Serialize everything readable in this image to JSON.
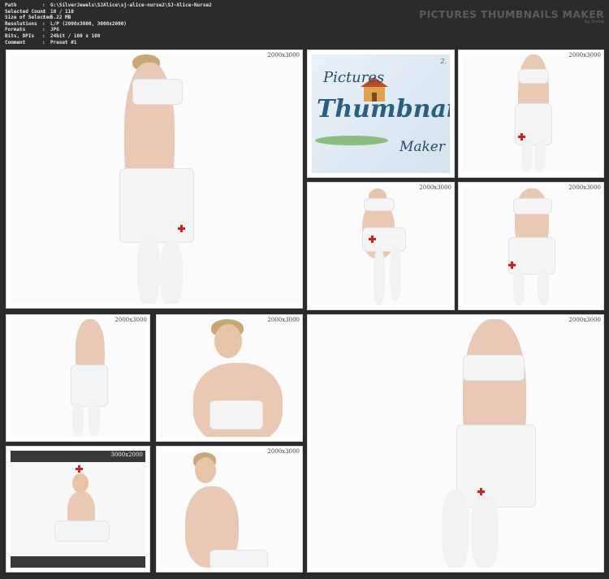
{
  "header": {
    "fields": [
      {
        "key": "Path",
        "value": "G:\\SilverJewels\\SJAlice\\sj-alice-nurse2\\SJ-Alice-Nurse2"
      },
      {
        "key": "Selected Count",
        "value": "10 / 110"
      },
      {
        "key": "Size of Selected",
        "value": "5.22 MB"
      },
      {
        "key": "Resolutions",
        "value": "L/P (2000x3000, 3000x2000)"
      },
      {
        "key": "Formats",
        "value": "JPG"
      },
      {
        "key": "Bits, DPIs",
        "value": "24bit / 100 x 100"
      },
      {
        "key": "Comment",
        "value": "Preset #1"
      }
    ],
    "separator": ":",
    "brand_title": "PICTURES THUMBNAILS MAKER",
    "brand_subtitle": "by Scorp"
  },
  "logo": {
    "word1": "Pictures",
    "word2": "Thumbnails",
    "word3": "Maker",
    "version": "2."
  },
  "thumbnails": [
    {
      "id": "t1",
      "resolution": "2000x3000",
      "orientation": "portrait"
    },
    {
      "id": "t3",
      "resolution": "2000x3000",
      "orientation": "portrait"
    },
    {
      "id": "t4",
      "resolution": "2000x3000",
      "orientation": "portrait"
    },
    {
      "id": "t5",
      "resolution": "2000x3000",
      "orientation": "portrait"
    },
    {
      "id": "t6",
      "resolution": "2000x3000",
      "orientation": "portrait"
    },
    {
      "id": "t7",
      "resolution": "2000x3000",
      "orientation": "portrait"
    },
    {
      "id": "t8",
      "resolution": "2000x3000",
      "orientation": "portrait"
    },
    {
      "id": "t9",
      "resolution": "3000x2000",
      "orientation": "landscape"
    },
    {
      "id": "t10",
      "resolution": "2000x3000",
      "orientation": "portrait"
    }
  ],
  "colors": {
    "background": "#2b2b2b",
    "tile": "#ffffff",
    "brand_text": "#5c5c5c",
    "cross": "#d02020"
  }
}
